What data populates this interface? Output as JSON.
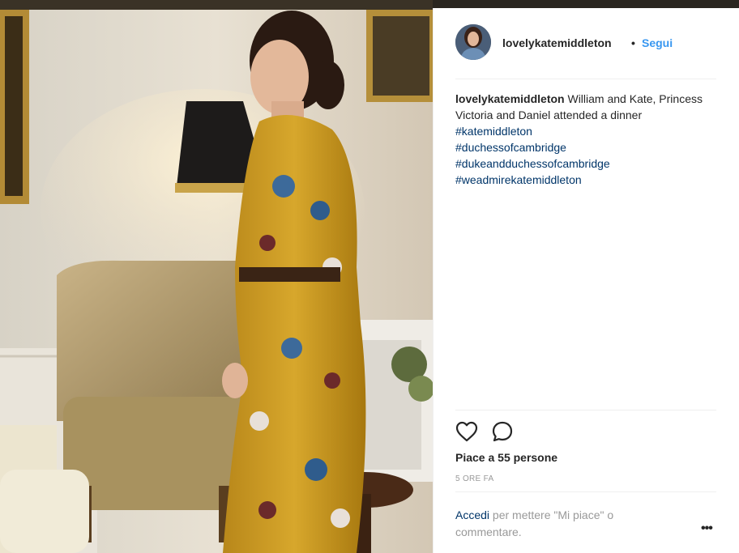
{
  "post": {
    "username": "lovelykatemiddleton",
    "separator": "•",
    "follow_label": "Segui",
    "caption_user": "lovelykatemiddleton",
    "caption_text": " William and Kate, Princess Victoria and Daniel attended a dinner ",
    "hashtags": [
      "#katemiddleton",
      "#duchessofcambridge",
      "#dukeandduchessofcambridge",
      "#weadmirekatemiddleton"
    ],
    "likes_text": "Piace a 55 persone",
    "time_text": "5 ORE FA",
    "login_link": "Accedi",
    "login_rest": " per mettere \"Mi piace\" o commentare.",
    "more_label": "•••"
  },
  "icons": {
    "like": "heart-outline-icon",
    "comment": "speech-bubble-icon",
    "more": "more-options-icon"
  },
  "colors": {
    "link_blue": "#3897f0",
    "hashtag": "#003569",
    "text": "#262626",
    "muted": "#999999",
    "dress": "#c99a1e"
  }
}
